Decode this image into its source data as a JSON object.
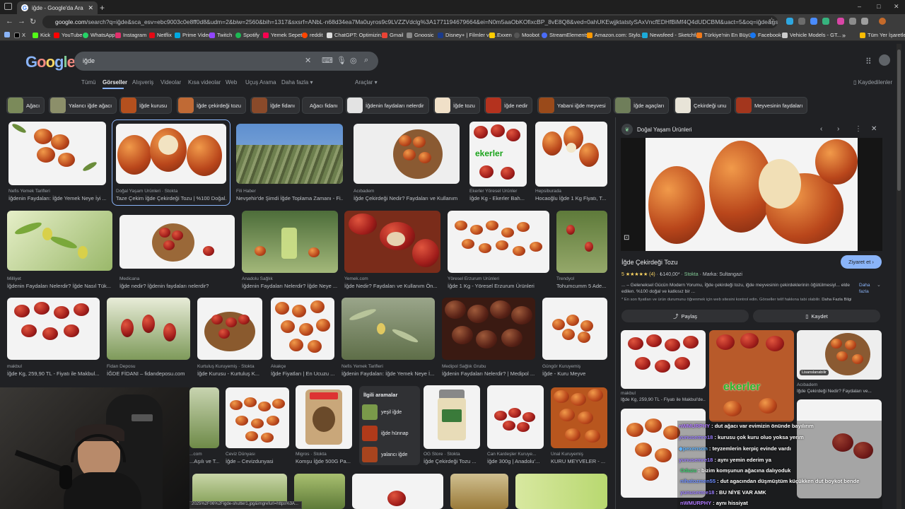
{
  "browser": {
    "tab_title": "iğde - Google'da Ara",
    "new_tab": "+",
    "window_controls": [
      "–",
      "□",
      "✕"
    ],
    "url_domain": "google.com",
    "url_rest": "/search?q=iğde&sca_esv=ebc9003c0e8ff0d8&udm=2&biw=2560&bih=1317&sxsrf=ANbL-n68d34ea7Ma0uyros9c9LVZZVdclg%3A1771194679664&ei=N0m5aaObKOfixcBP_8vE8Q8&ved=0ahUKEwjjktatstySAxVncfEDHfBiMf4Q4dUDCBM&uact=5&oq=iğde&gs_lp=Egtnd3Mtd2l6LWltZyIFaSc5fZGUyCBAAGIAEGLE...",
    "bookmarks": [
      "X",
      "Kick",
      "YouTube",
      "WhatsApp",
      "Instagram",
      "Netflix",
      "Prime Video",
      "Twitch",
      "Spotify",
      "Yemek Sepeti",
      "reddit",
      "ChatGPT: Optimizin...",
      "Gmail",
      "Gnoosic",
      "Disney+ | Filmler ve...",
      "Exxen",
      "Moobot",
      "StreamElements",
      "Amazon.com: Stylo...",
      "Newsfeed - Sketchfab",
      "Türkiye'nin En Büyü...",
      "Facebook",
      "Vehicle Models - GT..."
    ],
    "bookmarks_more": "»",
    "all_bookmarks": "Tüm Yer İşaretleri"
  },
  "google": {
    "logo": "Google",
    "query": "iğde",
    "filters": [
      "Tümü",
      "Görseller",
      "Alışveriş",
      "Videolar",
      "Kısa videolar",
      "Web",
      "Uçuş Arama",
      "Daha fazla ▾"
    ],
    "tools": "Araçlar ▾",
    "saved": "Kaydedilenler"
  },
  "chips": [
    "Ağacı",
    "Yalancı iğde ağacı",
    "İğde kurusu",
    "İğde çekirdeği tozu",
    "İğde fidanı",
    "Ağacı fidanı",
    "İğdenin faydaları nelerdir",
    "İğde tozu",
    "İğde nedir",
    "Yabani iğde meyvesi",
    "İğde agaçları",
    "Çekirdeği unu",
    "Meyvesinin faydaları"
  ],
  "row1": [
    {
      "source": "Nefis Yemek Tarifleri",
      "title": "İğdenin Faydaları: İğde Yemek Neye İyi ..."
    },
    {
      "source": "Doğal Yaşam Ürünleri · Stokta",
      "title": "Taze Çekim İğde Çekirdeği Tozu | %100 Doğal..."
    },
    {
      "source": "Fili Haber",
      "title": "Nevşehir'de Şimdi İğde Toplama Zamanı - Fi..."
    },
    {
      "source": "Acıbadem",
      "title": "İğde Çekirdeği Nedir? Faydaları ve Kullanım ..."
    },
    {
      "source": "Ekerler Yöresel Ürünler",
      "title": "İğde Kg - Ekerler Bah..."
    },
    {
      "source": "Hepsiburada",
      "title": "Hocaoğlu İğde 1 Kg Fiyatı, T..."
    }
  ],
  "row2": [
    {
      "source": "Milliyet",
      "title": "İğdenin Faydaları Nelerdir? İğde Nasıl Tük..."
    },
    {
      "source": "Medicana",
      "title": "İğde nedir? İğdenin faydaları nelerdir?"
    },
    {
      "source": "Anadolu Sağlık",
      "title": "İğdenin Faydaları Nelerdir? İğde Neye ..."
    },
    {
      "source": "Yemek.com",
      "title": "İğde Nedir? Faydaları ve Kullanım Ön..."
    },
    {
      "source": "Yöresel Erzurum Ürünleri",
      "title": "İğde 1 Kg - Yöresel Erzurum Ürünleri"
    },
    {
      "source": "Trendyol",
      "title": "Tohumcumm 5 Ade..."
    }
  ],
  "row3": [
    {
      "source": "makbul",
      "title": "İğde Kg, 259,90 TL - Fiyatı ile Makbul..."
    },
    {
      "source": "Fidan Deposu",
      "title": "İĞDE FİDANI – fidandeposu.com"
    },
    {
      "source": "Kurtuluş Kuruyemiş · Stokta",
      "title": "İğde Kurusu - Kurtuluş K..."
    },
    {
      "source": "Akakçe",
      "title": "İğde Fiyatları | En Ucuzu ..."
    },
    {
      "source": "Nefis Yemek Tarifleri",
      "title": "İğdenin Faydaları: İğde Yemek Neye İ..."
    },
    {
      "source": "Medipol Sağlık Grubu",
      "title": "İğdenin Faydaları Nelerdir? | Medipol ..."
    },
    {
      "source": "Güngör Kuruyemiş",
      "title": "İğde - Kuru Meyve"
    }
  ],
  "row4": [
    {
      "source": "...com",
      "title": "...Aşılı ve T..."
    },
    {
      "source": "Ceviz Dünyası",
      "title": "İğde – Cevizdunyasi"
    },
    {
      "source": "Migros · Stokta",
      "title": "Komşu İğde 500G Pa..."
    },
    {
      "source": "OG Store · Stokta",
      "title": "İğde Çekirdeği Tozu ..."
    },
    {
      "source": "Can Kardeşler Kuruye...",
      "title": "İğde 300g | Anadolu'..."
    },
    {
      "source": "Ünal Kuruyemiş",
      "title": "KURU MEYVELER - ..."
    }
  ],
  "related": {
    "heading": "İlgili aramalar",
    "items": [
      "yeşil iğde",
      "iğde hünnap",
      "yalancı iğde"
    ]
  },
  "panel": {
    "site": "Doğal Yaşam Ürünleri",
    "title": "İğde Çekirdeği Tozu",
    "rating": "5 ★★★★★ (4)",
    "price": "₺140,00*",
    "stock": "Stokta",
    "brand": "Marka: Sultangazi",
    "visit": "Ziyaret et ›",
    "desc": "... – Geleneksel Gücün Modern Yorumu, İğde çekirdeği tozu, iğde meyvesinin çekirdeklerinin öğütülmesiyl... elde edilen. %100 doğal ve katkısız bir ...",
    "more": "Daha fazla",
    "note": "* En son fiyatları ve ürün durumunu öğrenmek için web sitesini kontrol edin. Görseller telif hakkına tabi olabilir.",
    "note_link": "Daha Fazla Bilgi",
    "share": "Paylaş",
    "save": "Kaydet",
    "similar": [
      {
        "source": "makbul",
        "title": "İğde Kg, 259,90 TL - Fiyatı ile Makbul'de..."
      },
      {
        "source": "Ekerler",
        "title": ""
      },
      {
        "source": "Acıbadem",
        "title": "İğde Çekirdeği Nedir? Faydaları ve..."
      }
    ],
    "licensable": "Lisanslanabilir"
  },
  "status_url": "2025%2F06%2Figde-shutter1.jpg&imgrefurl=https%3A...",
  "chat": [
    {
      "user": "nWMURPHY",
      "msg": "dut ağacı var evimizin önünde bayılırım",
      "color": "#b07aff"
    },
    {
      "user": "yunusemre18",
      "msg": "kurusu çok kuru oluo yoksa yerim",
      "color": "#9b7dff"
    },
    {
      "user": "pexenson",
      "msg": "teyzemlerin kerpiç evinde vardı",
      "color": "#5fb4ff"
    },
    {
      "user": "yunusemre18",
      "msg": "aynı yemin ederim ya",
      "color": "#9b7dff"
    },
    {
      "user": "Oduzu",
      "msg": "bizim komşunun ağacına dalıyoduk",
      "color": "#3cd070"
    },
    {
      "user": "nihatozmen55",
      "msg": "dut agacından düşmüştüm küçükken dut boykot bende",
      "color": "#6b8cff"
    },
    {
      "user": "yunusemre18",
      "msg": "BU NİYE VAR AMK",
      "color": "#9b7dff"
    },
    {
      "user": "nWMURPHY",
      "msg": "aynı hissiyat",
      "color": "#b07aff"
    }
  ]
}
